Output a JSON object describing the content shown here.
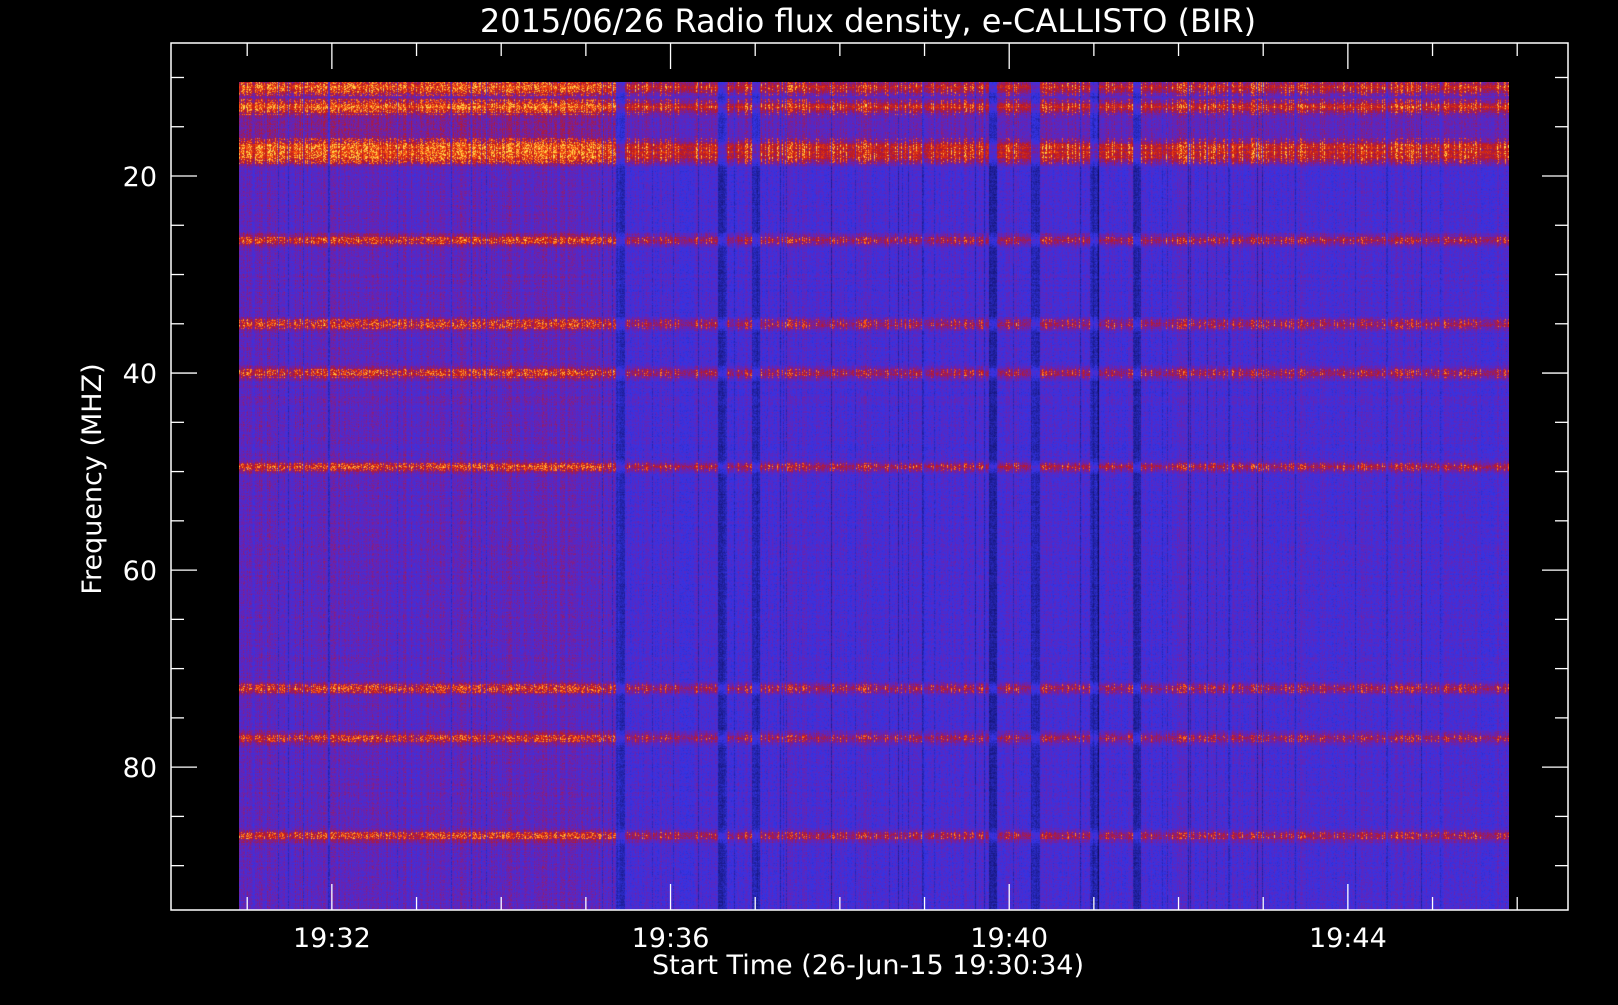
{
  "chart_data": {
    "type": "heatmap",
    "title": "2015/06/26  Radio flux density, e-CALLISTO (BIR)",
    "xlabel": "Start Time (26-Jun-15 19:30:34)",
    "ylabel": "Frequency (MHZ)",
    "x_ticks": [
      {
        "label": "19:32",
        "minutes": 92
      },
      {
        "label": "19:36",
        "minutes": 96
      },
      {
        "label": "19:40",
        "minutes": 100
      },
      {
        "label": "19:44",
        "minutes": 104
      }
    ],
    "y_ticks": [
      {
        "label": "20",
        "value": 20
      },
      {
        "label": "40",
        "value": 40
      },
      {
        "label": "60",
        "value": 60
      },
      {
        "label": "80",
        "value": 80
      }
    ],
    "xlim_minutes": [
      90.1,
      106.6
    ],
    "ylim_mhz": [
      94.5,
      6.5
    ],
    "data_extent": {
      "start_minutes": 90.9,
      "end_minutes": 105.9,
      "freq_top": 10.5,
      "freq_bottom": 94.5
    },
    "y_reversed": true,
    "grid": false,
    "bright_bands_mhz": [
      11,
      13,
      17,
      18,
      26.5,
      35,
      40,
      49.5,
      72,
      77,
      87
    ],
    "dark_time_bands_minutes": [
      95.4,
      96.6,
      97.0,
      99.8,
      100.3,
      101.0,
      101.5
    ],
    "colors": {
      "background": "#000000",
      "low": "#0a0a50",
      "mid_low": "#3434e6",
      "mid": "#6a22b0",
      "mid_high": "#c21818",
      "high": "#ff5a10",
      "peak": "#ffd84a",
      "axis": "#ffffff"
    }
  }
}
